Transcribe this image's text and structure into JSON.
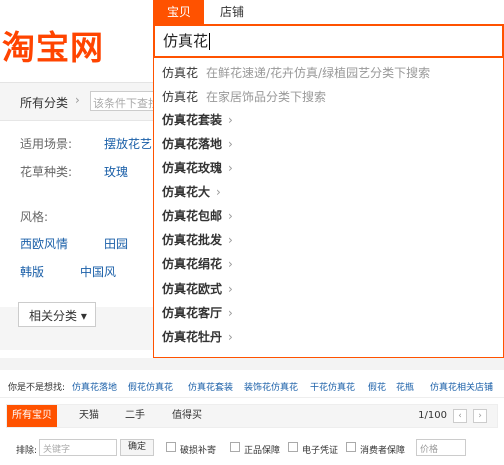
{
  "logo": {
    "text": "淘宝网"
  },
  "filters": {
    "category_label": "所有分类",
    "narrow_placeholder": "该条件下查找",
    "scene_label": "适用场景:",
    "scene_value": "摆放花艺",
    "type_label": "花草种类:",
    "type_value": "玫瑰",
    "style_label": "风格:",
    "styles": [
      "西欧风情",
      "田园",
      "韩版",
      "中国风"
    ],
    "related_button": "相关分类 ▾"
  },
  "search": {
    "tabs": [
      "宝贝",
      "店铺"
    ],
    "query": "仿真花",
    "suggestions": [
      {
        "kw": "仿真花",
        "hint": "在鲜花速递/花卉仿真/绿植园艺分类下搜索",
        "type": "scoped"
      },
      {
        "kw": "仿真花",
        "hint": "在家居饰品分类下搜索",
        "type": "scoped"
      },
      {
        "kw": "仿真花套装",
        "type": "expand"
      },
      {
        "kw": "仿真花落地",
        "type": "expand"
      },
      {
        "kw": "仿真花玫瑰",
        "type": "expand"
      },
      {
        "kw": "仿真花大",
        "type": "expand"
      },
      {
        "kw": "仿真花包邮",
        "type": "expand"
      },
      {
        "kw": "仿真花批发",
        "type": "expand"
      },
      {
        "kw": "仿真花绢花",
        "type": "expand"
      },
      {
        "kw": "仿真花欧式",
        "type": "expand"
      },
      {
        "kw": "仿真花客厅",
        "type": "expand"
      },
      {
        "kw": "仿真花牡丹",
        "type": "expand"
      }
    ]
  },
  "results": {
    "did_you_mean_label": "你是不是想找:",
    "did_you_mean": [
      "仿真花落地",
      "假花仿真花",
      "仿真花套装",
      "装饰花仿真花",
      "干花仿真花",
      "假花",
      "花瓶",
      "仿真花相关店铺"
    ],
    "tabs": [
      "所有宝贝",
      "天猫",
      "二手",
      "值得买"
    ],
    "page_info": "1/100",
    "exclude_label": "排除:",
    "exclude_placeholder": "关键字",
    "confirm_button": "确定",
    "checkboxes": [
      "破损补寄",
      "正品保障",
      "电子凭证",
      "消费者保障"
    ],
    "sort_placeholder": "价格"
  },
  "colors": {
    "accent": "#ff5200",
    "link": "#1a5fa8"
  }
}
